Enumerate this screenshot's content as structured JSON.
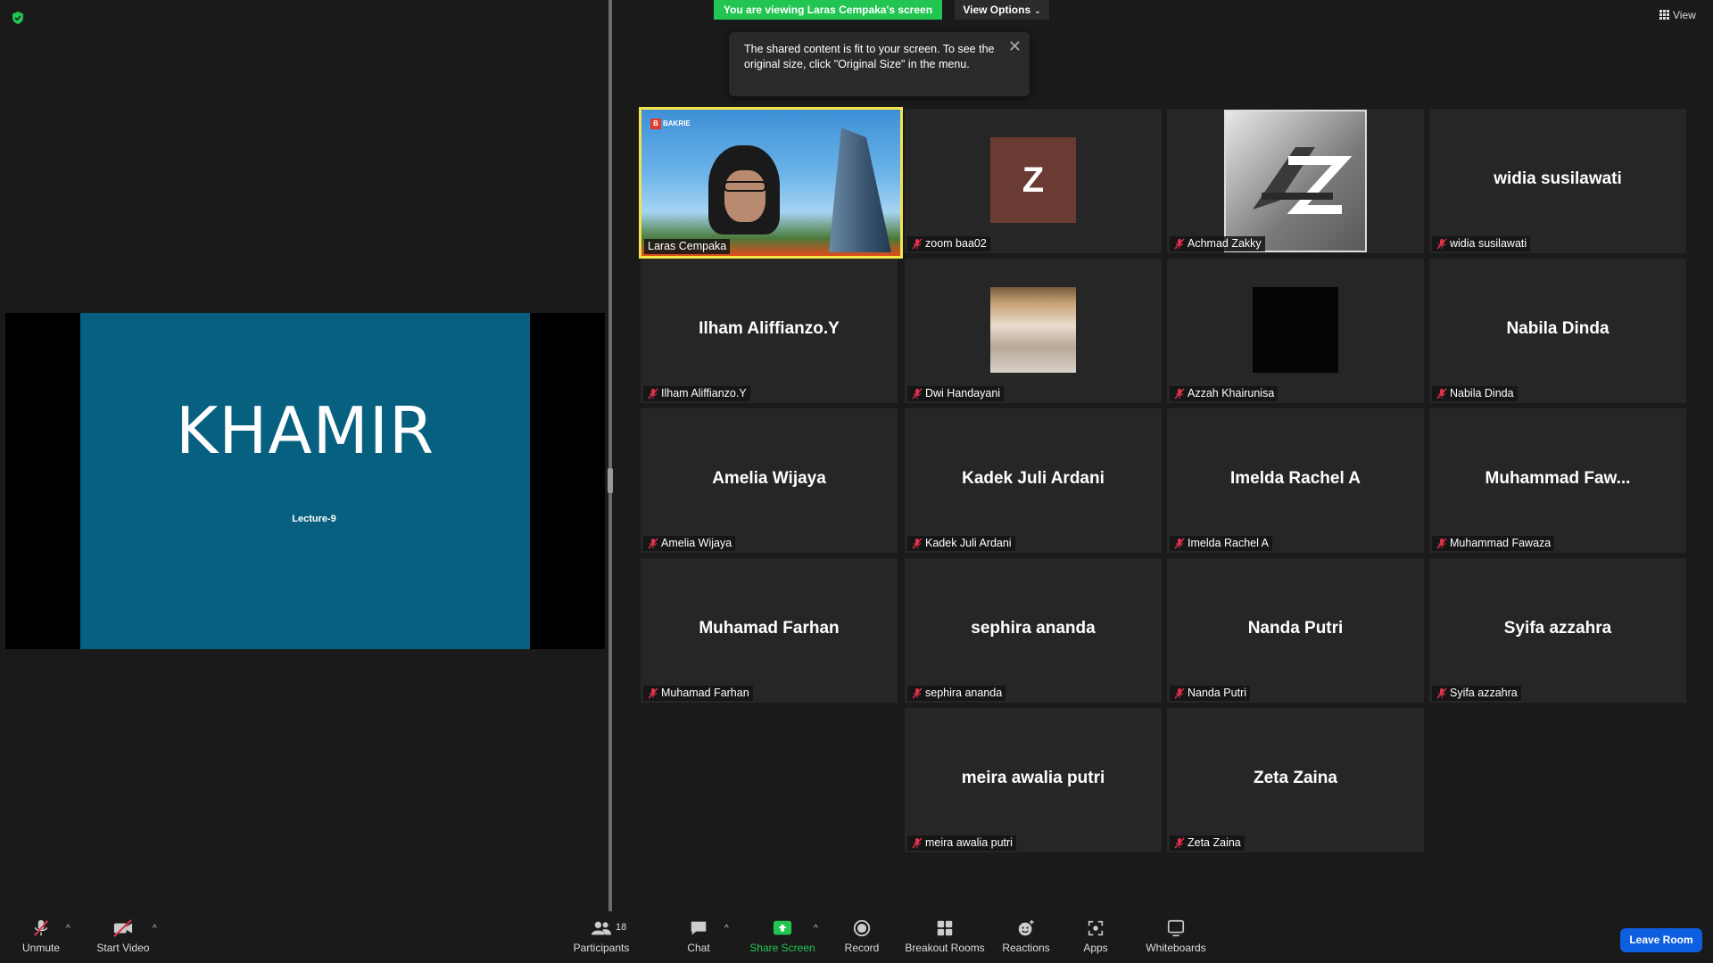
{
  "banner": {
    "viewing_text": "You are viewing Laras Cempaka's screen",
    "view_options_label": "View Options"
  },
  "tooltip": {
    "text": "The shared content is fit to your screen. To see the original size, click \"Original Size\" in the menu."
  },
  "view_button_label": "View",
  "slide": {
    "title": "KHAMIR",
    "subtitle": "Lecture-9"
  },
  "gallery": {
    "participants": [
      {
        "tile_name": "",
        "tag": "Laras Cempaka",
        "muted": false,
        "kind": "video",
        "active": true
      },
      {
        "tile_name": "",
        "tag": "zoom baa02",
        "muted": true,
        "kind": "letter",
        "letter": "Z",
        "color": "#6a3b32"
      },
      {
        "tile_name": "",
        "tag": "Achmad Zakky",
        "muted": true,
        "kind": "logo"
      },
      {
        "tile_name": "widia susilawati",
        "tag": "widia susilawati",
        "muted": true,
        "kind": "name"
      },
      {
        "tile_name": "Ilham Aliffianzo.Y",
        "tag": "Ilham Aliffianzo.Y",
        "muted": true,
        "kind": "name"
      },
      {
        "tile_name": "",
        "tag": "Dwi Handayani",
        "muted": true,
        "kind": "photo"
      },
      {
        "tile_name": "",
        "tag": "Azzah Khairunisa",
        "muted": true,
        "kind": "black"
      },
      {
        "tile_name": "Nabila Dinda",
        "tag": "Nabila Dinda",
        "muted": true,
        "kind": "name"
      },
      {
        "tile_name": "Amelia Wijaya",
        "tag": "Amelia Wijaya",
        "muted": true,
        "kind": "name"
      },
      {
        "tile_name": "Kadek Juli Ardani",
        "tag": "Kadek Juli Ardani",
        "muted": true,
        "kind": "name"
      },
      {
        "tile_name": "Imelda Rachel A",
        "tag": "Imelda Rachel A",
        "muted": true,
        "kind": "name"
      },
      {
        "tile_name": "Muhammad  Faw...",
        "tag": "Muhammad Fawaza",
        "muted": true,
        "kind": "name"
      },
      {
        "tile_name": "Muhamad Farhan",
        "tag": "Muhamad Farhan",
        "muted": true,
        "kind": "name"
      },
      {
        "tile_name": "sephira ananda",
        "tag": "sephira ananda",
        "muted": true,
        "kind": "name"
      },
      {
        "tile_name": "Nanda Putri",
        "tag": "Nanda Putri",
        "muted": true,
        "kind": "name"
      },
      {
        "tile_name": "Syifa azzahra",
        "tag": "Syifa azzahra",
        "muted": true,
        "kind": "name"
      },
      {
        "tile_name": "meira awalia putri",
        "tag": "meira awalia putri",
        "muted": true,
        "kind": "name"
      },
      {
        "tile_name": "Zeta Zaina",
        "tag": "Zeta Zaina",
        "muted": true,
        "kind": "name"
      }
    ]
  },
  "video_logo_text": "BAKRIE",
  "toolbar": {
    "unmute": "Unmute",
    "start_video": "Start Video",
    "participants": "Participants",
    "participant_count": "18",
    "chat": "Chat",
    "share_screen": "Share Screen",
    "record": "Record",
    "breakout_rooms": "Breakout Rooms",
    "reactions": "Reactions",
    "apps": "Apps",
    "whiteboards": "Whiteboards",
    "leave_room": "Leave Room"
  },
  "colors": {
    "banner_green": "#23c552",
    "slide_bg": "#07607f",
    "active_speaker_border": "#f4e44a",
    "leave_button": "#0e5ee0",
    "muted_mic_red": "#e0314b"
  }
}
